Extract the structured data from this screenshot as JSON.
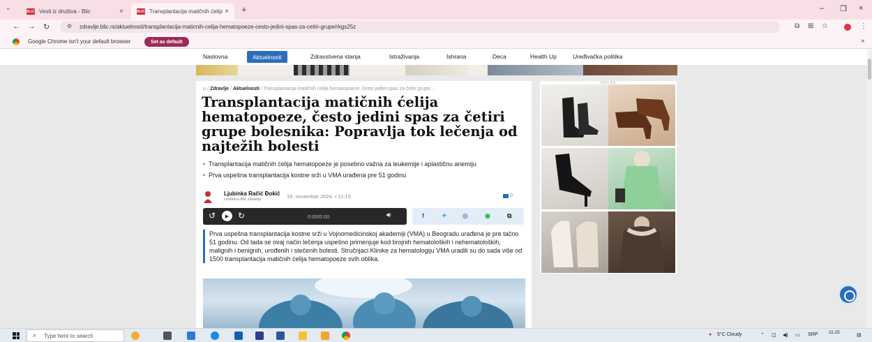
{
  "browser": {
    "tabs": [
      {
        "label": "Vesti iz društva - Blic",
        "favicon": "blic"
      },
      {
        "label": "Transplantacija matičnih ćelija",
        "favicon": "blic"
      }
    ],
    "url": "zdravlje.blic.rs/aktuelnosti/transplantacija-maticnih-celija-hematopoeze-cesto-jedini-spas-za-cetiri-grupe/rkgs25z",
    "infobar_message": "Google Chrome isn't your default browser",
    "set_default_label": "Set as default"
  },
  "site_nav": {
    "items": [
      "Naslovna",
      "Aktuelnosti",
      "Zdravstvena stanja",
      "Istraživanja",
      "Ishrana",
      "Deca",
      "Health Up",
      "Uređivačka politika"
    ],
    "active": "Aktuelnosti"
  },
  "article": {
    "breadcrumb": {
      "section": "Zdravlje",
      "category": "Aktuelnosti",
      "current": "Transplantacija matičnih ćelija hematopoeze, često jedini spas za četiri grupe...",
      "sep": "/"
    },
    "headline": "Transplantacija matičnih ćelija hematopoeze, često jedini spas za četiri grupe bolesnika: Popravlja tok lečenja od najtežih bolesti",
    "bullets": [
      "Transplantacija matičnih ćelija hematopoeze je posebno važna za leukemije i aplastičnu anemiju",
      "Prva uspešna transplantacija kostne srži u VMA urađena pre 51 godinu"
    ],
    "author_name": "Ljubinka Račić Đokić",
    "author_role": "Urednica Blic zdravlja",
    "date": "15. novembar 2024.",
    "date_sep": "•",
    "time": "11:15",
    "comments": "0",
    "player_time": "0:00/0:00",
    "lead": "Prva uspešna transplantacija kostne srži u Vojnomedicinskoj akademiji (VMA) u Beogradu urađena je pre tačno 51 godinu. Od tada se ovaj način lečenja uspešno primenjuje kod brojnih hematoloških i nehematoloških, malignih i benignih, urođenih i stečenih bolesti. Stručnjaci Klinike za hematologiju VMA uradili su do sada više od 1500 transplantacija matičnih ćelija hematopoeze svih oblika."
  },
  "ad": {
    "label": "OGLAS"
  },
  "taskbar": {
    "search_placeholder": "Type here to search",
    "weather": "5°C Cloudy",
    "lang": "SRP",
    "time": "11:25"
  },
  "colors": {
    "accent": "#2a6ebb",
    "brand_red": "#d62730",
    "player": "#282828"
  },
  "icons": [
    "home-icon",
    "rewind-icon",
    "play-icon",
    "forward-icon",
    "volume-icon",
    "facebook-icon",
    "twitter-icon",
    "viber-icon",
    "whatsapp-icon",
    "copy-icon",
    "comment-icon",
    "chat-icon"
  ]
}
